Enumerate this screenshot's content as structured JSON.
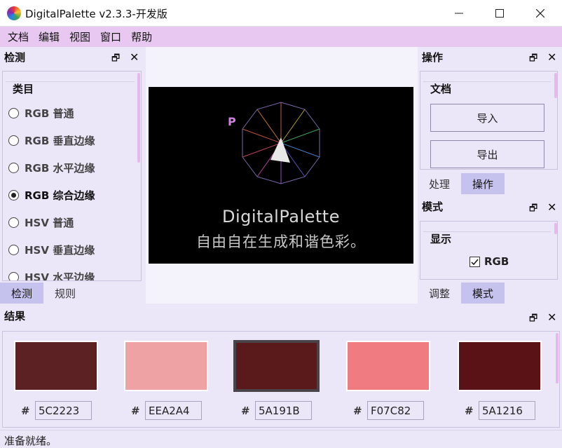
{
  "window": {
    "title": "DigitalPalette v2.3.3-开发版"
  },
  "menu": [
    "文档",
    "编辑",
    "视图",
    "窗口",
    "帮助"
  ],
  "left_dock": {
    "title": "检测",
    "group_label": "类目",
    "options": [
      {
        "label": "RGB 普通",
        "selected": false
      },
      {
        "label": "RGB 垂直边缘",
        "selected": false
      },
      {
        "label": "RGB 水平边缘",
        "selected": false
      },
      {
        "label": "RGB 综合边缘",
        "selected": true
      },
      {
        "label": "HSV 普通",
        "selected": false
      },
      {
        "label": "HSV 垂直边缘",
        "selected": false
      },
      {
        "label": "HSV 水平边缘",
        "selected": false
      }
    ],
    "tabs": [
      "检测",
      "规则"
    ]
  },
  "splash": {
    "logo_letters": [
      "D",
      "I",
      "G",
      "I",
      "T",
      "A",
      "L",
      "P",
      "A",
      "L",
      "E",
      "T",
      "T",
      "E"
    ],
    "name": "DigitalPalette",
    "slogan": "自由自在生成和谐色彩。"
  },
  "right_top_dock": {
    "title": "操作",
    "group_label": "文档",
    "import_label": "导入",
    "export_label": "导出",
    "tabs": [
      "处理",
      "操作"
    ]
  },
  "right_bottom_dock": {
    "title": "模式",
    "group_label": "显示",
    "checkbox_label": "RGB",
    "checkbox_checked": true,
    "tabs": [
      "调整",
      "模式"
    ]
  },
  "result_dock": {
    "title": "结果",
    "hash": "#",
    "swatches": [
      {
        "hex": "5C2223",
        "color": "#5C2223",
        "selected": false
      },
      {
        "hex": "EEA2A4",
        "color": "#EEA2A4",
        "selected": false
      },
      {
        "hex": "5A191B",
        "color": "#5A191B",
        "selected": true
      },
      {
        "hex": "F07C82",
        "color": "#F07C82",
        "selected": false
      },
      {
        "hex": "5A1216",
        "color": "#5A1216",
        "selected": false
      }
    ]
  },
  "status": "准备就绪。"
}
